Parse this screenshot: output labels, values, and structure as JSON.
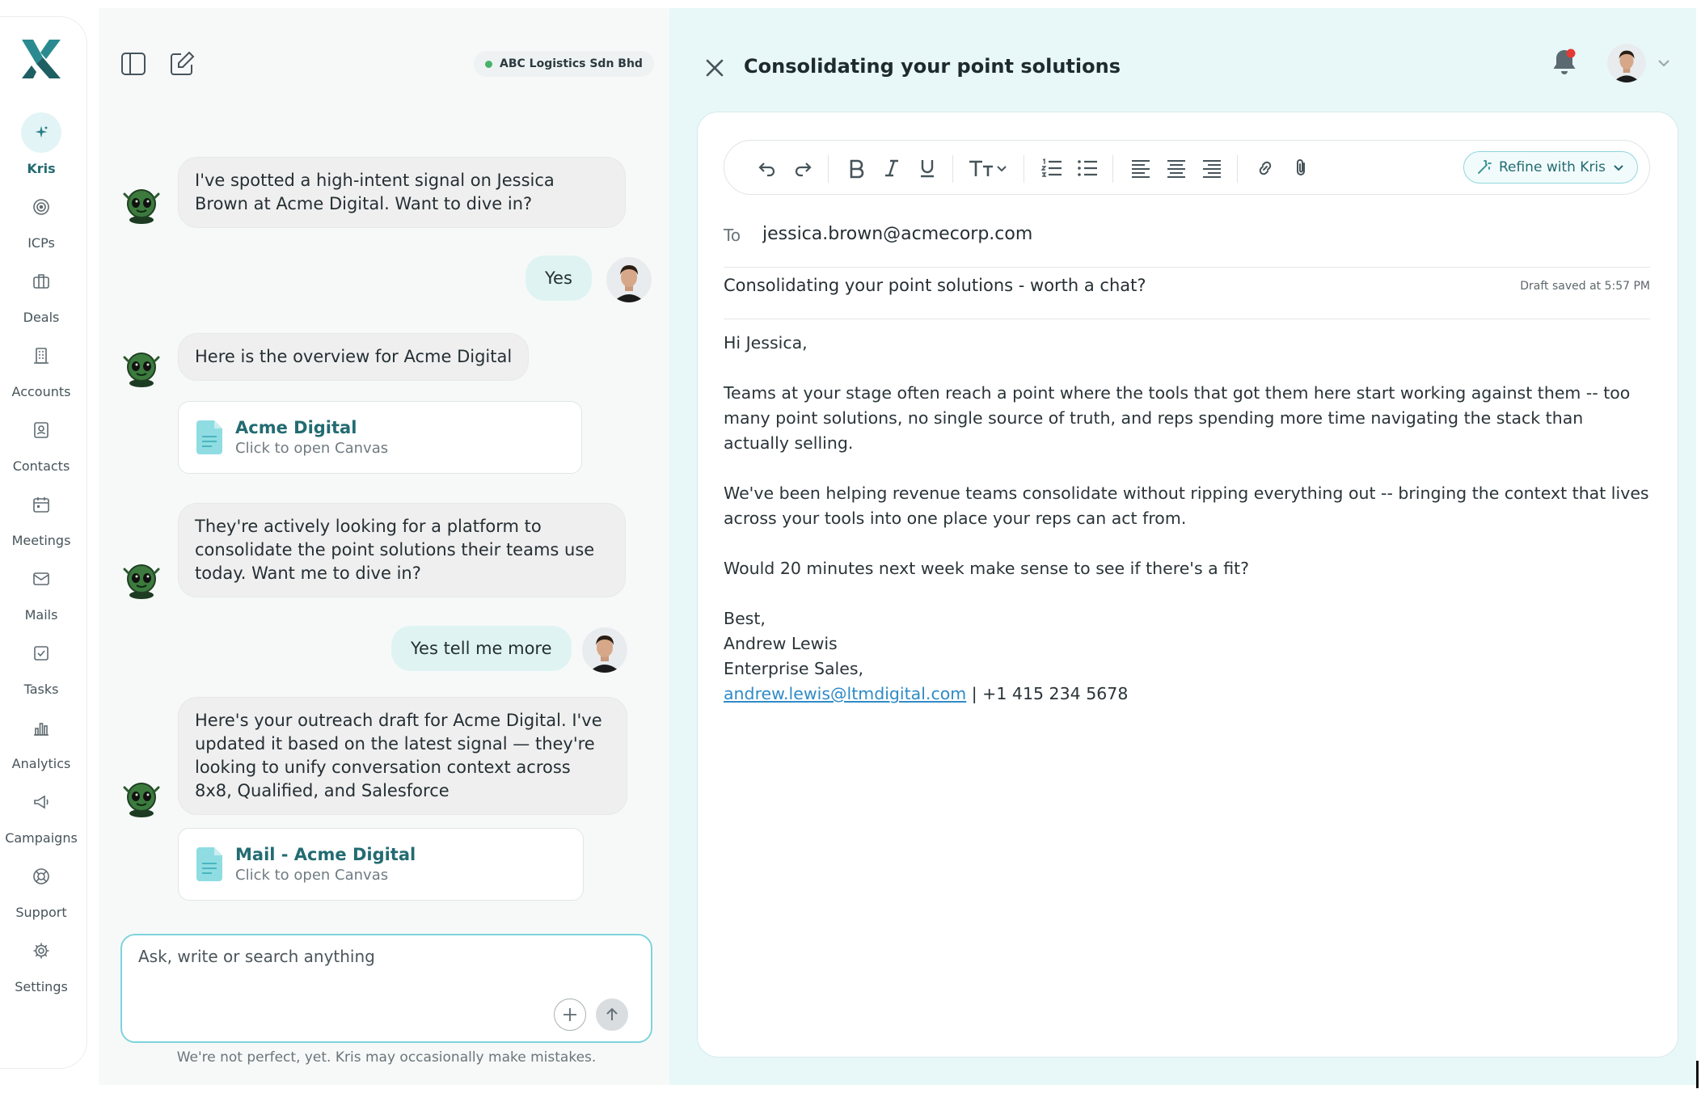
{
  "sidebar": {
    "items": [
      {
        "label": "Kris",
        "icon": "sparkle-icon",
        "active": true
      },
      {
        "label": "ICPs",
        "icon": "target-icon"
      },
      {
        "label": "Deals",
        "icon": "briefcase-icon"
      },
      {
        "label": "Accounts",
        "icon": "building-icon"
      },
      {
        "label": "Contacts",
        "icon": "contact-card-icon"
      },
      {
        "label": "Meetings",
        "icon": "calendar-icon"
      },
      {
        "label": "Mails",
        "icon": "mail-icon"
      },
      {
        "label": "Tasks",
        "icon": "checkbox-icon"
      },
      {
        "label": "Analytics",
        "icon": "bar-chart-icon"
      },
      {
        "label": "Campaigns",
        "icon": "megaphone-icon"
      },
      {
        "label": "Support",
        "icon": "lifebuoy-icon"
      },
      {
        "label": "Settings",
        "icon": "gear-icon"
      }
    ]
  },
  "chat": {
    "org_name": "ABC Logistics Sdn Bhd",
    "messages": {
      "m1": "I've spotted a high-intent signal on Jessica Brown at Acme Digital. Want to dive in?",
      "m2": "Yes",
      "m3": "Here is the overview for Acme Digital",
      "card1_title": "Acme Digital",
      "card1_sub": "Click to open Canvas",
      "m4": "They're actively looking for a platform to consolidate the point solutions their teams use today. Want me to dive in?",
      "m5": "Yes tell me more",
      "m6": "Here's your outreach draft for Acme Digital. I've updated it based on the latest signal — they're looking to unify conversation context across 8x8, Qualified, and Salesforce",
      "card2_title": "Mail - Acme Digital",
      "card2_sub": "Click to open Canvas"
    },
    "input_placeholder": "Ask, write or search anything",
    "disclaimer": "We're not perfect, yet. Kris may occasionally make mistakes."
  },
  "editor": {
    "title": "Consolidating your point solutions",
    "refine_label": "Refine with Kris",
    "to_label": "To",
    "to_value": "jessica.brown@acmecorp.com",
    "subject": "Consolidating your point solutions - worth a chat?",
    "draft_status": "Draft saved at 5:57 PM",
    "body": {
      "greeting": "Hi Jessica,",
      "p1": "Teams at your stage often reach a point where the tools that got them here start working against them -- too many point solutions, no single source of truth, and reps spending more time navigating the stack than actually selling.",
      "p2": "We've been helping revenue teams consolidate without ripping everything out -- bringing the context that lives across your tools into one place your reps can act from.",
      "p3": "Would 20 minutes next week make sense to see if there's a fit?",
      "sign_off": "Best,",
      "sender_name": "Andrew Lewis",
      "sender_title": "Enterprise Sales,",
      "sender_email": "andrew.lewis@ltmdigital.com",
      "sender_phone": " | +1 415 234 5678"
    }
  },
  "colors": {
    "accent": "#236b72",
    "active_nav_bg": "#e3f4f6",
    "user_bubble": "#dff4f2",
    "right_pane_bg": "#e8f7f7",
    "link": "#2f8bc7",
    "notification_dot": "#e53935",
    "status_dot": "#47b36a"
  }
}
